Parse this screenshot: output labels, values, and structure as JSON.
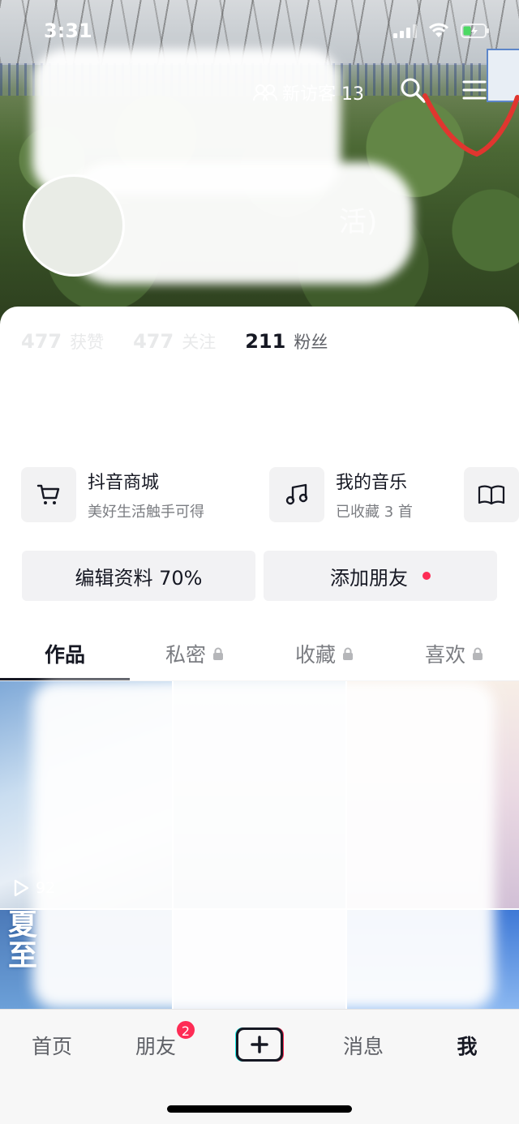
{
  "status_bar": {
    "time": "3:31"
  },
  "header": {
    "visitor_label": "新访客 13",
    "visible_name_fragment": "活)"
  },
  "stats": [
    {
      "value": "477",
      "label": "获赞"
    },
    {
      "value": "477",
      "label": "关注"
    },
    {
      "value": "211",
      "label": "粉丝"
    }
  ],
  "services": [
    {
      "icon": "cart-icon",
      "title": "抖音商城",
      "subtitle": "美好生活触手可得"
    },
    {
      "icon": "music-note-icon",
      "title": "我的音乐",
      "subtitle": "已收藏 3 首"
    },
    {
      "icon": "book-icon"
    }
  ],
  "actions": {
    "edit_profile": "编辑资料 70%",
    "add_friend": "添加朋友"
  },
  "tabs": [
    {
      "label": "作品",
      "locked": false,
      "active": true
    },
    {
      "label": "私密",
      "locked": true,
      "active": false
    },
    {
      "label": "收藏",
      "locked": true,
      "active": false
    },
    {
      "label": "喜欢",
      "locked": true,
      "active": false
    }
  ],
  "videos": {
    "first_play_count": "92",
    "thumb_text": "夏\n至"
  },
  "bottom_nav": [
    {
      "label": "首页",
      "active": false
    },
    {
      "label": "朋友",
      "active": false,
      "badge": "2"
    },
    {
      "label": "+",
      "active": false
    },
    {
      "label": "消息",
      "active": false
    },
    {
      "label": "我",
      "active": true
    }
  ],
  "colors": {
    "accent_red": "#fe2c55",
    "text_primary": "#161823",
    "text_secondary": "#7b7d82"
  }
}
